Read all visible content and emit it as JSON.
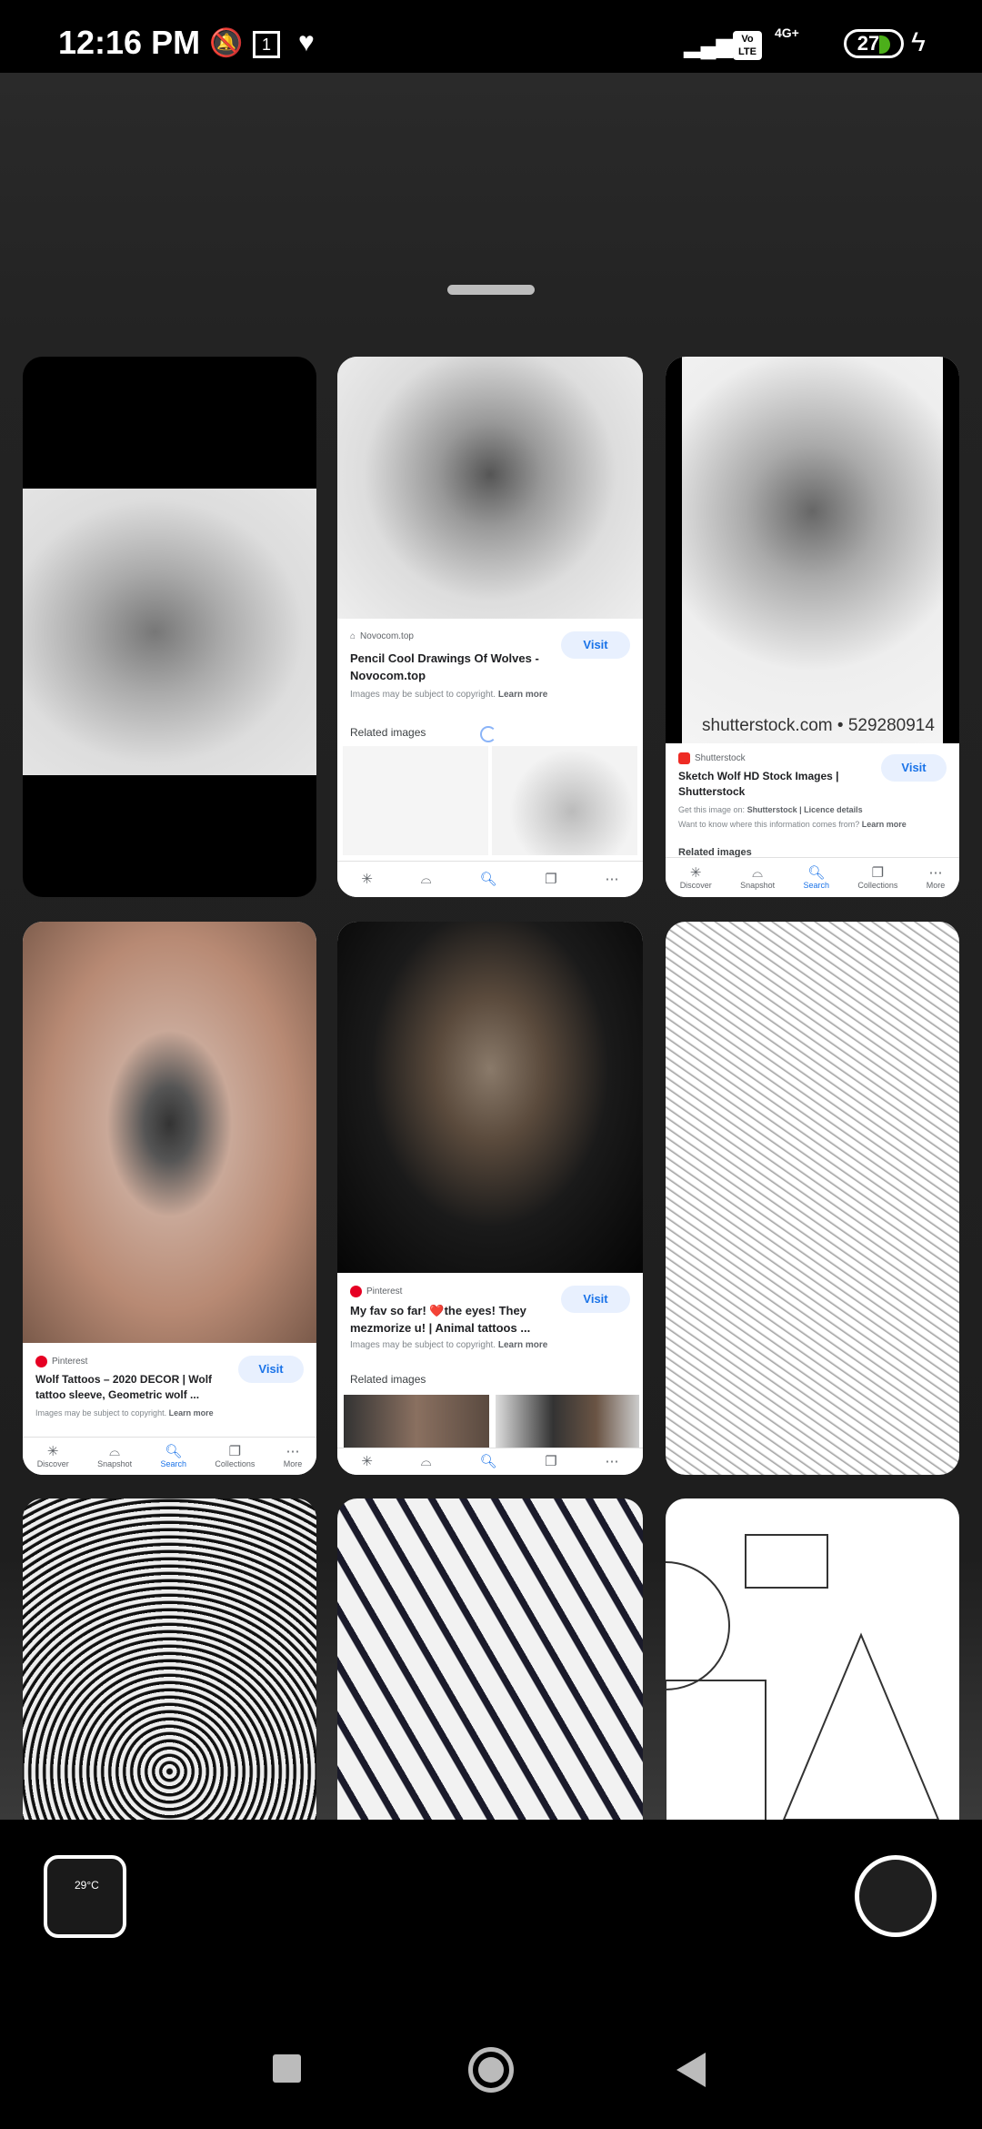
{
  "status_bar": {
    "time": "12:16 PM",
    "battery": "27",
    "icons": [
      "bell-off-icon",
      "calendar-icon",
      "heart-check-icon",
      "signal-icon",
      "volte-icon",
      "4g-plus-signal-icon",
      "battery-icon",
      "charging-icon"
    ],
    "volte": "Vo LTE",
    "network": "4G+"
  },
  "results": [
    {
      "type": "image",
      "name": "crying-girl-sketch"
    },
    {
      "type": "detail",
      "source": "Novocom.top",
      "title": "Pencil Cool Drawings Of Wolves - Novocom.top",
      "copyright": "Images may be subject to copyright.",
      "learn_more": "Learn more",
      "visit": "Visit",
      "related": "Related images",
      "nav": [
        {
          "label": "",
          "icon": "discover-icon"
        },
        {
          "label": "",
          "icon": "snapshot-icon"
        },
        {
          "label": "",
          "icon": "search-icon"
        },
        {
          "label": "",
          "icon": "collections-icon"
        },
        {
          "label": "",
          "icon": "more-icon"
        }
      ]
    },
    {
      "type": "detail",
      "source": "Shutterstock",
      "watermark": "shutterstock.com • 529280914",
      "title": "Sketch Wolf HD Stock Images | Shutterstock",
      "copyright": "Get this image on:",
      "copyright_bold": "Shutterstock | Licence details",
      "info2": "Want to know where this information comes from?",
      "learn_more": "Learn more",
      "visit": "Visit",
      "related": "Related images",
      "nav": [
        {
          "label": "Discover"
        },
        {
          "label": "Snapshot"
        },
        {
          "label": "Search"
        },
        {
          "label": "Collections"
        },
        {
          "label": "More"
        }
      ]
    },
    {
      "type": "detail",
      "source": "Pinterest",
      "title": "Wolf Tattoos – 2020 DECOR | Wolf tattoo sleeve, Geometric wolf ...",
      "copyright": "Images may be subject to copyright.",
      "learn_more": "Learn more",
      "visit": "Visit",
      "nav": [
        {
          "label": "Discover"
        },
        {
          "label": "Snapshot"
        },
        {
          "label": "Search"
        },
        {
          "label": "Collections"
        },
        {
          "label": "More"
        }
      ]
    },
    {
      "type": "detail",
      "source": "Pinterest",
      "title": "My fav so far! ❤️the eyes! They mezmorize u! | Animal tattoos ...",
      "copyright": "Images may be subject to copyright.",
      "learn_more": "Learn more",
      "visit": "Visit",
      "related": "Related images"
    },
    {
      "type": "image",
      "name": "geometric-face-sketch"
    },
    {
      "type": "image",
      "name": "op-art-pattern"
    },
    {
      "type": "image",
      "name": "feather-drawings"
    },
    {
      "type": "image",
      "name": "geometric-shapes-sketch"
    }
  ],
  "camera": {
    "thumb_temp": "29°C"
  },
  "colors": {
    "accent": "#1a73e8",
    "visit_bg": "#e8f0fe",
    "pinterest": "#e60023",
    "shutterstock": "#ee2b24"
  }
}
